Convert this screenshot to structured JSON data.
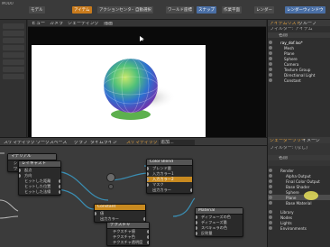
{
  "menubar": {
    "items": [
      "Model",
      "Topology",
      "UV",
      "Paint",
      "Layout",
      "Setup",
      "Animate",
      "Render",
      "Games",
      "Items"
    ],
    "buttons": [
      "モデル",
      "アイテム",
      "アクションセンター",
      "自動選択",
      "ワールド座標",
      "スナップ",
      "作業平面",
      "ジンバル",
      "レンダー",
      "レンダーウィンドウ"
    ]
  },
  "viewport": {
    "tabs": [
      "カメラ",
      "シェーディング",
      "描画"
    ],
    "label": "ビュー"
  },
  "items_panel": {
    "tabs": [
      "アイテムリスト",
      "グループ",
      "ディープ"
    ],
    "filter": "フィルター: アイテム",
    "column": "名前",
    "rows": [
      "ray_dof.lxo*",
      "Mesh",
      "Plane",
      "Sphere",
      "Camera",
      "Texture Group",
      "Directional Light",
      "Constant"
    ]
  },
  "schematic": {
    "tabs": [
      "スケマティック",
      "ワークスペース",
      "グラフ",
      "タイムライン",
      "スケマティック"
    ],
    "search": "追加...",
    "nodes": {
      "node_a": {
        "title": "マテリアル",
        "rows": [
          "シェーディング法線",
          "ワールド位置"
        ]
      },
      "node_b": {
        "title": "レイキャスト",
        "rows": [
          "起点",
          "方向",
          "ヒットした距離",
          "ヒットした位置",
          "ヒットした法線"
        ]
      },
      "color_blend": {
        "title": "Color Blend",
        "rows": [
          "ブレンド量",
          "入力カラー1",
          "入力カラー2",
          "マスク",
          "出力カラー"
        ]
      },
      "constant": {
        "title": "Constant",
        "rows": [
          "値",
          "出力カラー"
        ]
      },
      "material": {
        "title": "Material",
        "rows": [
          "ディフューズの色",
          "ディフューズ量",
          "スペキュラの色",
          "反射量",
          "屈折率"
        ]
      },
      "node_tex": {
        "title": "テクスチャ",
        "rows": [
          "テクスチャ値",
          "テクスチャ色",
          "テクスチャ透明度"
        ]
      }
    }
  },
  "shader_panel": {
    "tabs": [
      "シェーダーツリー",
      "イメージ",
      "レイヤー"
    ],
    "filter": "フィルター: (なし)",
    "column": "名前",
    "rows": [
      "Render",
      "Alpha Output",
      "Final Color Output",
      "Base Shader",
      "Sphere",
      "Plane",
      "Base Material",
      "Library",
      "Nodes",
      "Lights",
      "Environments"
    ]
  },
  "colors": {
    "accent": "#c87a1c",
    "node_highlight": "#c88a20",
    "selection_blue": "#4a6fa5",
    "wire_blue": "#3a8fb5"
  }
}
